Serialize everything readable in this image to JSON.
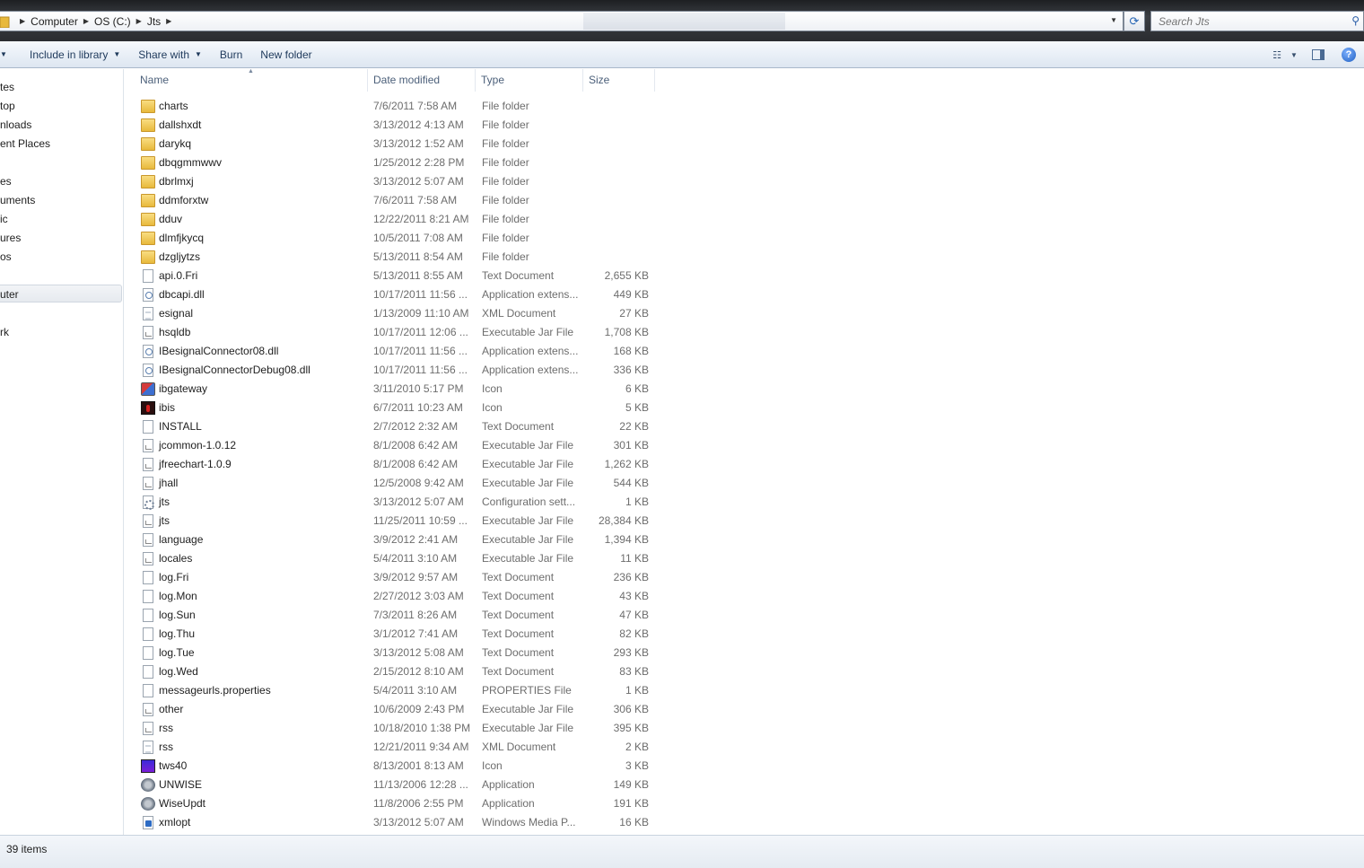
{
  "address": {
    "crumbs": [
      "Computer",
      "OS (C:)",
      "Jts"
    ]
  },
  "search": {
    "placeholder": "Search Jts"
  },
  "commands": {
    "include_in_library": "Include in library",
    "share_with": "Share with",
    "burn": "Burn",
    "new_folder": "New folder"
  },
  "nav": {
    "items": [
      "tes",
      "top",
      "nloads",
      "ent Places",
      "es",
      "uments",
      "ic",
      "ures",
      "os",
      "uter",
      "rk"
    ],
    "selected": "uter"
  },
  "columns": {
    "name": "Name",
    "date": "Date modified",
    "type": "Type",
    "size": "Size"
  },
  "files": [
    {
      "name": "charts",
      "date": "7/6/2011 7:58 AM",
      "type": "File folder",
      "size": "",
      "icon": "folder-icon"
    },
    {
      "name": "dallshxdt",
      "date": "3/13/2012 4:13 AM",
      "type": "File folder",
      "size": "",
      "icon": "folder-icon"
    },
    {
      "name": "darykq",
      "date": "3/13/2012 1:52 AM",
      "type": "File folder",
      "size": "",
      "icon": "folder-icon"
    },
    {
      "name": "dbqgmmwwv",
      "date": "1/25/2012 2:28 PM",
      "type": "File folder",
      "size": "",
      "icon": "folder-icon"
    },
    {
      "name": "dbrlmxj",
      "date": "3/13/2012 5:07 AM",
      "type": "File folder",
      "size": "",
      "icon": "folder-icon"
    },
    {
      "name": "ddmforxtw",
      "date": "7/6/2011 7:58 AM",
      "type": "File folder",
      "size": "",
      "icon": "folder-icon"
    },
    {
      "name": "dduv",
      "date": "12/22/2011 8:21 AM",
      "type": "File folder",
      "size": "",
      "icon": "folder-icon"
    },
    {
      "name": "dlmfjkycq",
      "date": "10/5/2011 7:08 AM",
      "type": "File folder",
      "size": "",
      "icon": "folder-icon"
    },
    {
      "name": "dzgljytzs",
      "date": "5/13/2011 8:54 AM",
      "type": "File folder",
      "size": "",
      "icon": "folder-icon"
    },
    {
      "name": "api.0.Fri",
      "date": "5/13/2011 8:55 AM",
      "type": "Text Document",
      "size": "2,655 KB",
      "icon": "text-document-icon"
    },
    {
      "name": "dbcapi.dll",
      "date": "10/17/2011 11:56 ...",
      "type": "Application extens...",
      "size": "449 KB",
      "icon": "dll-icon"
    },
    {
      "name": "esignal",
      "date": "1/13/2009 11:10 AM",
      "type": "XML Document",
      "size": "27 KB",
      "icon": "xml-document-icon"
    },
    {
      "name": "hsqldb",
      "date": "10/17/2011 12:06 ...",
      "type": "Executable Jar File",
      "size": "1,708 KB",
      "icon": "jar-file-icon"
    },
    {
      "name": "IBesignalConnector08.dll",
      "date": "10/17/2011 11:56 ...",
      "type": "Application extens...",
      "size": "168 KB",
      "icon": "dll-icon"
    },
    {
      "name": "IBesignalConnectorDebug08.dll",
      "date": "10/17/2011 11:56 ...",
      "type": "Application extens...",
      "size": "336 KB",
      "icon": "dll-icon"
    },
    {
      "name": "ibgateway",
      "date": "3/11/2010 5:17 PM",
      "type": "Icon",
      "size": "6 KB",
      "icon": "ibgateway-icon"
    },
    {
      "name": "ibis",
      "date": "6/7/2011 10:23 AM",
      "type": "Icon",
      "size": "5 KB",
      "icon": "ibis-icon"
    },
    {
      "name": "INSTALL",
      "date": "2/7/2012 2:32 AM",
      "type": "Text Document",
      "size": "22 KB",
      "icon": "text-document-icon"
    },
    {
      "name": "jcommon-1.0.12",
      "date": "8/1/2008 6:42 AM",
      "type": "Executable Jar File",
      "size": "301 KB",
      "icon": "jar-file-icon"
    },
    {
      "name": "jfreechart-1.0.9",
      "date": "8/1/2008 6:42 AM",
      "type": "Executable Jar File",
      "size": "1,262 KB",
      "icon": "jar-file-icon"
    },
    {
      "name": "jhall",
      "date": "12/5/2008 9:42 AM",
      "type": "Executable Jar File",
      "size": "544 KB",
      "icon": "jar-file-icon"
    },
    {
      "name": "jts",
      "date": "3/13/2012 5:07 AM",
      "type": "Configuration sett...",
      "size": "1 KB",
      "icon": "config-file-icon"
    },
    {
      "name": "jts",
      "date": "11/25/2011 10:59 ...",
      "type": "Executable Jar File",
      "size": "28,384 KB",
      "icon": "jar-file-icon"
    },
    {
      "name": "language",
      "date": "3/9/2012 2:41 AM",
      "type": "Executable Jar File",
      "size": "1,394 KB",
      "icon": "jar-file-icon"
    },
    {
      "name": "locales",
      "date": "5/4/2011 3:10 AM",
      "type": "Executable Jar File",
      "size": "11 KB",
      "icon": "jar-file-icon"
    },
    {
      "name": "log.Fri",
      "date": "3/9/2012 9:57 AM",
      "type": "Text Document",
      "size": "236 KB",
      "icon": "text-document-icon"
    },
    {
      "name": "log.Mon",
      "date": "2/27/2012 3:03 AM",
      "type": "Text Document",
      "size": "43 KB",
      "icon": "text-document-icon"
    },
    {
      "name": "log.Sun",
      "date": "7/3/2011 8:26 AM",
      "type": "Text Document",
      "size": "47 KB",
      "icon": "text-document-icon"
    },
    {
      "name": "log.Thu",
      "date": "3/1/2012 7:41 AM",
      "type": "Text Document",
      "size": "82 KB",
      "icon": "text-document-icon"
    },
    {
      "name": "log.Tue",
      "date": "3/13/2012 5:08 AM",
      "type": "Text Document",
      "size": "293 KB",
      "icon": "text-document-icon"
    },
    {
      "name": "log.Wed",
      "date": "2/15/2012 8:10 AM",
      "type": "Text Document",
      "size": "83 KB",
      "icon": "text-document-icon"
    },
    {
      "name": "messageurls.properties",
      "date": "5/4/2011 3:10 AM",
      "type": "PROPERTIES File",
      "size": "1 KB",
      "icon": "text-document-icon"
    },
    {
      "name": "other",
      "date": "10/6/2009 2:43 PM",
      "type": "Executable Jar File",
      "size": "306 KB",
      "icon": "jar-file-icon"
    },
    {
      "name": "rss",
      "date": "10/18/2010 1:38 PM",
      "type": "Executable Jar File",
      "size": "395 KB",
      "icon": "jar-file-icon"
    },
    {
      "name": "rss",
      "date": "12/21/2011 9:34 AM",
      "type": "XML Document",
      "size": "2 KB",
      "icon": "xml-document-icon"
    },
    {
      "name": "tws40",
      "date": "8/13/2001 8:13 AM",
      "type": "Icon",
      "size": "3 KB",
      "icon": "tws40-icon"
    },
    {
      "name": "UNWISE",
      "date": "11/13/2006 12:28 ...",
      "type": "Application",
      "size": "149 KB",
      "icon": "application-icon"
    },
    {
      "name": "WiseUpdt",
      "date": "11/8/2006 2:55 PM",
      "type": "Application",
      "size": "191 KB",
      "icon": "application-icon"
    },
    {
      "name": "xmlopt",
      "date": "3/13/2012 5:07 AM",
      "type": "Windows Media P...",
      "size": "16 KB",
      "icon": "media-playlist-icon"
    }
  ],
  "status": {
    "item_count": "39 items"
  }
}
